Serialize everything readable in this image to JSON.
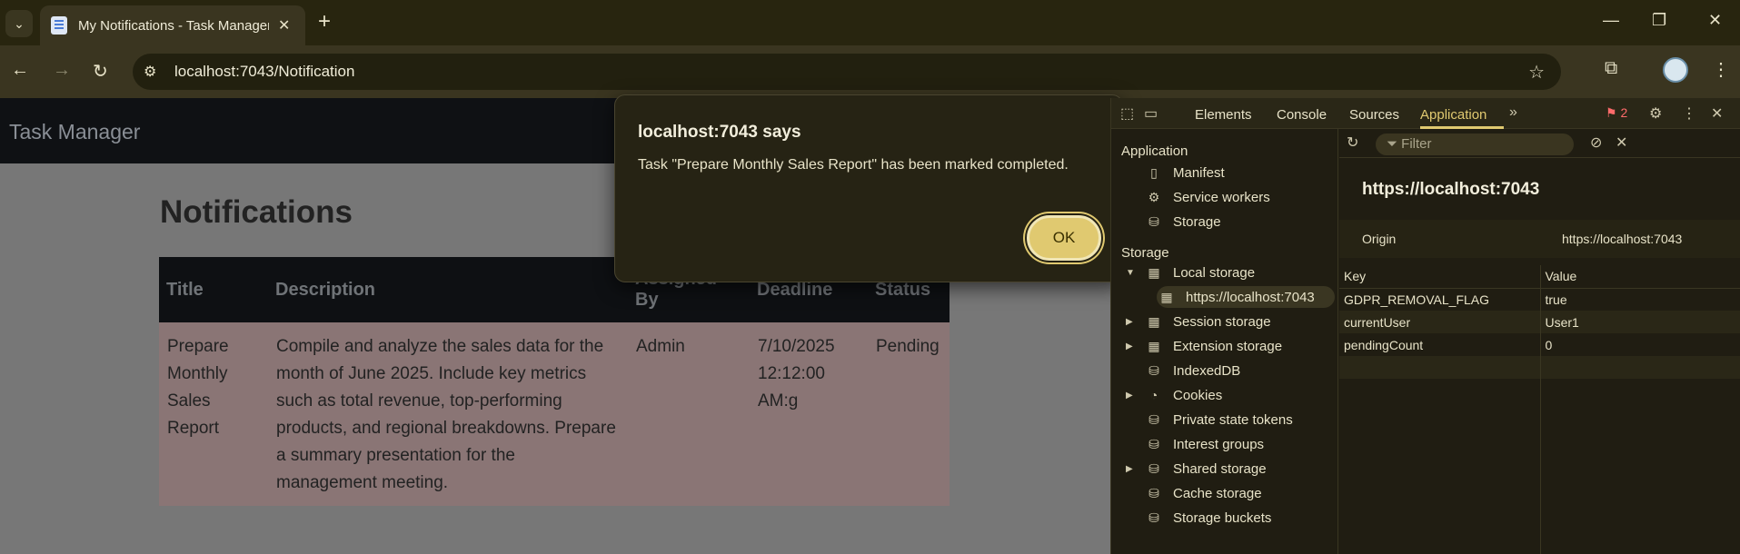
{
  "browser": {
    "tab_title": "My Notifications - Task Manager",
    "url": "localhost:7043/Notification",
    "window": {
      "minimize": "—",
      "restore": "❐",
      "close": "✕"
    }
  },
  "page": {
    "brand": "Task Manager",
    "heading": "Notifications",
    "columns": [
      "Title",
      "Description",
      "Assigned By",
      "Deadline",
      "Status"
    ],
    "rows": [
      {
        "title": "Prepare Monthly Sales Report",
        "description": "Compile and analyze the sales data for the month of June 2025. Include key metrics such as total revenue, top-performing products, and regional breakdowns. Prepare a summary presentation for the management meeting.",
        "assigned_by": "Admin",
        "deadline": "7/10/2025 12:12:00 AM:g",
        "status": "Pending"
      }
    ]
  },
  "dialog": {
    "title": "localhost:7043 says",
    "message": "Task \"Prepare Monthly Sales Report\" has been marked completed.",
    "ok_label": "OK"
  },
  "devtools": {
    "tabs": [
      "Elements",
      "Console",
      "Sources",
      "Application"
    ],
    "active_tab": "Application",
    "error_count": "2",
    "sidebar": {
      "application_header": "Application",
      "application_items": [
        "Manifest",
        "Service workers",
        "Storage"
      ],
      "storage_header": "Storage",
      "storage_items": [
        "Local storage",
        "https://localhost:7043",
        "Session storage",
        "Extension storage",
        "IndexedDB",
        "Cookies",
        "Private state tokens",
        "Interest groups",
        "Shared storage",
        "Cache storage",
        "Storage buckets"
      ]
    },
    "filter_placeholder": "Filter",
    "origin_heading": "https://localhost:7043",
    "origin_label": "Origin",
    "origin_value": "https://localhost:7043",
    "kv_headers": [
      "Key",
      "Value"
    ],
    "kv_rows": [
      {
        "key": "GDPR_REMOVAL_FLAG",
        "value": "true"
      },
      {
        "key": "currentUser",
        "value": "User1"
      },
      {
        "key": "pendingCount",
        "value": "0"
      }
    ]
  },
  "colors": {
    "accent": "#e0c970",
    "chrome": "#3a3520",
    "page_overlay": "#777777"
  }
}
